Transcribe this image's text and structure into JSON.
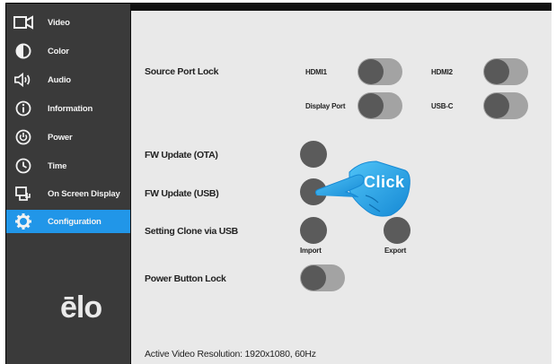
{
  "sidebar": {
    "items": [
      {
        "label": "Video",
        "icon": "video-camera-icon",
        "active": false
      },
      {
        "label": "Color",
        "icon": "contrast-icon",
        "active": false
      },
      {
        "label": "Audio",
        "icon": "speaker-icon",
        "active": false
      },
      {
        "label": "Information",
        "icon": "info-icon",
        "active": false
      },
      {
        "label": "Power",
        "icon": "power-icon",
        "active": false
      },
      {
        "label": "Time",
        "icon": "clock-icon",
        "active": false
      },
      {
        "label": "On Screen Display",
        "icon": "osd-icon",
        "active": false
      },
      {
        "label": "Configuration",
        "icon": "gear-icon",
        "active": true
      }
    ],
    "logo": "ēlo"
  },
  "settings": {
    "source_port_lock": {
      "label": "Source Port Lock",
      "ports": [
        "HDMI1",
        "HDMI2",
        "Display Port",
        "USB-C"
      ]
    },
    "fw_update_ota": {
      "label": "FW Update (OTA)"
    },
    "fw_update_usb": {
      "label": "FW Update (USB)"
    },
    "setting_clone": {
      "label": "Setting Clone via USB",
      "import_label": "Import",
      "export_label": "Export"
    },
    "power_button_lock": {
      "label": "Power Button Lock"
    },
    "active_video_resolution": "Active Video Resolution:  1920x1080, 60Hz"
  },
  "overlay": {
    "click_text": "Click"
  },
  "colors": {
    "sidebar_bg": "#3a3a3a",
    "active_item": "#2196e8",
    "main_bg": "#e9e9e9",
    "toggle_track": "#a3a3a3",
    "toggle_knob": "#595959",
    "hand_cursor": "#1fa3e6"
  }
}
